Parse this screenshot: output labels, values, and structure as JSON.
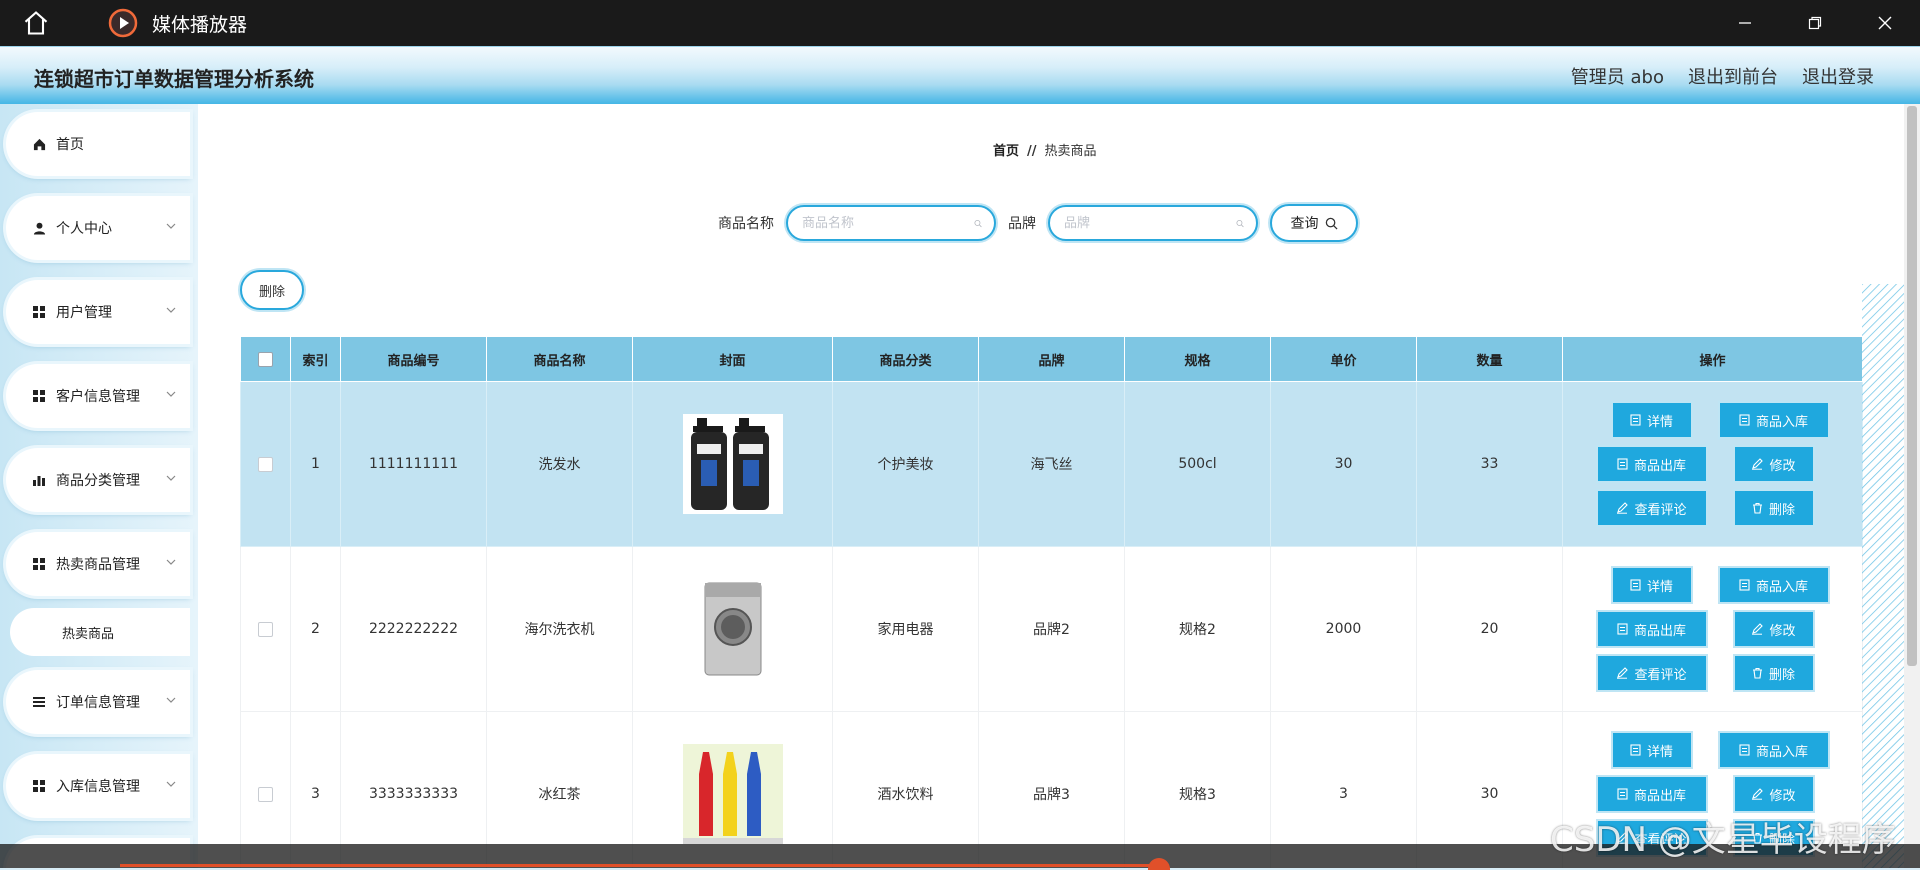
{
  "player": {
    "title": "媒体播放器"
  },
  "header": {
    "title": "连锁超市订单数据管理分析系统",
    "admin": "管理员 abo",
    "front": "退出到前台",
    "logout": "退出登录"
  },
  "sidebar": {
    "items": [
      {
        "label": "首页",
        "icon": "home-icon"
      },
      {
        "label": "个人中心",
        "icon": "user-icon"
      },
      {
        "label": "用户管理",
        "icon": "grid-icon"
      },
      {
        "label": "客户信息管理",
        "icon": "grid-icon"
      },
      {
        "label": "商品分类管理",
        "icon": "bar-chart-icon"
      },
      {
        "label": "热卖商品管理",
        "icon": "grid-icon"
      },
      {
        "label": "订单信息管理",
        "icon": "list-icon"
      },
      {
        "label": "入库信息管理",
        "icon": "grid-icon"
      }
    ],
    "sub_item": "热卖商品"
  },
  "breadcrumb": {
    "home": "首页",
    "sep": "//",
    "current": "热卖商品"
  },
  "search": {
    "name_label": "商品名称",
    "name_placeholder": "商品名称",
    "brand_label": "品牌",
    "brand_placeholder": "品牌",
    "query_label": "查询"
  },
  "delete_label": "删除",
  "table": {
    "headers": [
      "索引",
      "商品编号",
      "商品名称",
      "封面",
      "商品分类",
      "品牌",
      "规格",
      "单价",
      "数量",
      "操作"
    ],
    "rows": [
      {
        "index": "1",
        "code": "1111111111",
        "name": "洗发水",
        "category": "个护美妆",
        "brand": "海飞丝",
        "spec": "500cl",
        "price": "30",
        "qty": "33"
      },
      {
        "index": "2",
        "code": "2222222222",
        "name": "海尔洗衣机",
        "category": "家用电器",
        "brand": "品牌2",
        "spec": "规格2",
        "price": "2000",
        "qty": "20"
      },
      {
        "index": "3",
        "code": "3333333333",
        "name": "冰红茶",
        "category": "酒水饮料",
        "brand": "品牌3",
        "spec": "规格3",
        "price": "3",
        "qty": "30"
      }
    ]
  },
  "ops": {
    "detail": "详情",
    "stock_in": "商品入库",
    "stock_out": "商品出库",
    "edit": "修改",
    "reviews": "查看评论",
    "delete": "删除"
  },
  "watermark": "CSDN @文星毕设程序"
}
